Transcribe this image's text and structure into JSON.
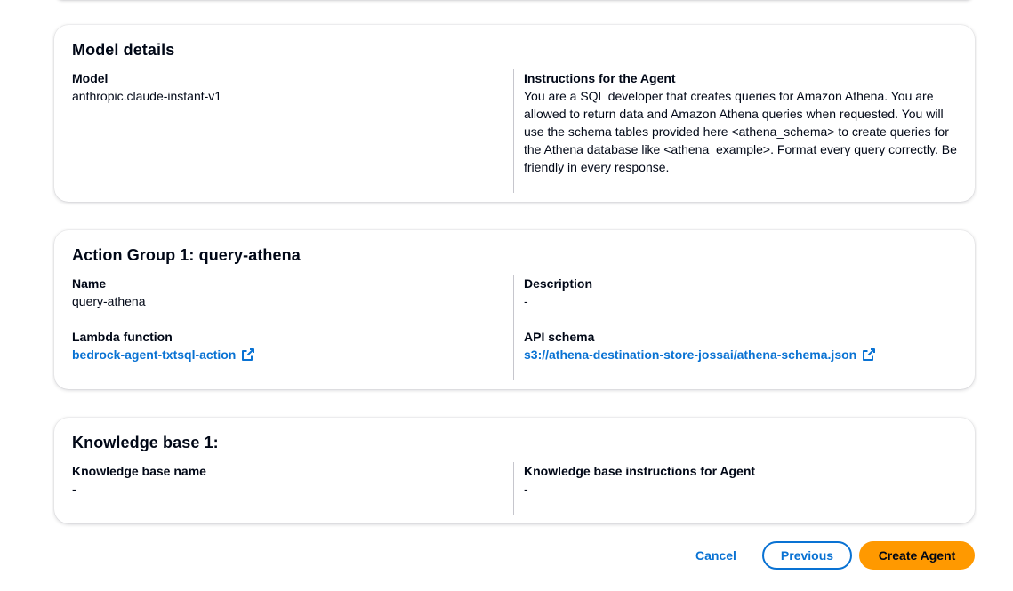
{
  "model_details": {
    "title": "Model details",
    "model_label": "Model",
    "model_value": "anthropic.claude-instant-v1",
    "instructions_label": "Instructions for the Agent",
    "instructions_value": "You are a SQL developer that creates queries for Amazon Athena. You are allowed to return data and Amazon Athena queries when requested. You will use the schema tables provided here <athena_schema> to create queries for the Athena database like <athena_example>. Format every query correctly. Be friendly in every response."
  },
  "action_group": {
    "title": "Action Group 1: query-athena",
    "name_label": "Name",
    "name_value": "query-athena",
    "description_label": "Description",
    "description_value": "-",
    "lambda_label": "Lambda function",
    "lambda_value": "bedrock-agent-txtsql-action",
    "api_schema_label": "API schema",
    "api_schema_value": "s3://athena-destination-store-jossai/athena-schema.json"
  },
  "knowledge_base": {
    "title": "Knowledge base 1:",
    "name_label": "Knowledge base name",
    "name_value": "-",
    "instructions_label": "Knowledge base instructions for Agent",
    "instructions_value": "-"
  },
  "footer": {
    "cancel_label": "Cancel",
    "previous_label": "Previous",
    "create_label": "Create Agent"
  },
  "icons": {
    "external_link": "external-link-icon"
  },
  "colors": {
    "link": "#0972d3",
    "primary_button": "#ff9900",
    "text": "#000716",
    "divider": "#c6c6cd"
  }
}
